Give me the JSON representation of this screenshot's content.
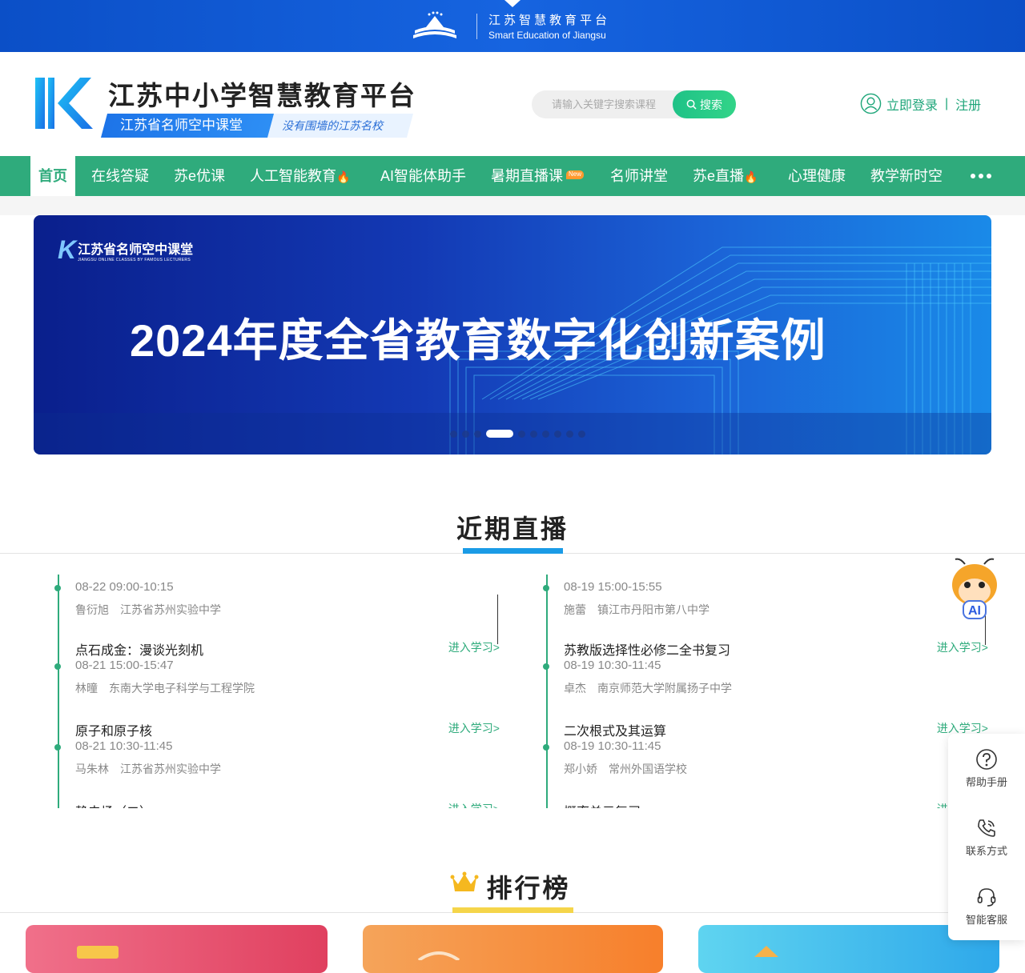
{
  "topbar": {
    "title_cn": "江苏智慧教育平台",
    "title_en": "Smart Education of Jiangsu"
  },
  "header": {
    "title": "江苏中小学智慧教育平台",
    "subtitle": "江苏省名师空中课堂",
    "slogan": "没有围墙的江苏名校",
    "search": {
      "placeholder": "请输入关键字搜索课程",
      "button": "搜索"
    },
    "login": "立即登录",
    "register": "注册"
  },
  "nav": {
    "items": [
      {
        "label": "首页",
        "active": true
      },
      {
        "label": "在线答疑"
      },
      {
        "label": "苏e优课"
      },
      {
        "label": "人工智能教育",
        "badge": "fire"
      },
      {
        "label": "AI智能体助手"
      },
      {
        "label": "暑期直播课",
        "badge": "New"
      },
      {
        "label": "名师讲堂"
      },
      {
        "label": "苏e直播",
        "badge": "fire"
      },
      {
        "label": "心理健康"
      },
      {
        "label": "教学新时空"
      }
    ],
    "more_icon": "more-dots-icon"
  },
  "banner": {
    "logo_title": "江苏省名师空中课堂",
    "logo_sub": "JIANGSU ONLINE CLASSES BY FAMOUS LECTURERS",
    "headline": "2024年度全省教育数字化创新案例",
    "active_slide": 3,
    "slide_count": 10
  },
  "live_section": {
    "title": "近期直播",
    "enter_label": "进入学习>",
    "left": [
      {
        "title": "",
        "time": "08-22 09:00-10:15",
        "teacher": "鲁衍旭",
        "school": "江苏省苏州实验中学"
      },
      {
        "title": "点石成金：漫谈光刻机",
        "time": "08-21 15:00-15:47",
        "teacher": "林曈",
        "school": "东南大学电子科学与工程学院"
      },
      {
        "title": "原子和原子核",
        "time": "08-21 10:30-11:45",
        "teacher": "马朱林",
        "school": "江苏省苏州实验中学"
      },
      {
        "title": "静电场（二）",
        "time": "",
        "teacher": "",
        "school": ""
      }
    ],
    "right": [
      {
        "title": "",
        "time": "08-19 15:00-15:55",
        "teacher": "施蕾",
        "school": "镇江市丹阳市第八中学"
      },
      {
        "title": "苏教版选择性必修二全书复习",
        "time": "08-19 10:30-11:45",
        "teacher": "卓杰",
        "school": "南京师范大学附属扬子中学"
      },
      {
        "title": "二次根式及其运算",
        "time": "08-19 10:30-11:45",
        "teacher": "郑小娇",
        "school": "常州外国语学校"
      },
      {
        "title": "概率单元复习",
        "time": "",
        "teacher": "",
        "school": ""
      }
    ]
  },
  "rank_section": {
    "title": "排行榜"
  },
  "side_tools": [
    {
      "label": "帮助手册",
      "icon": "help-icon"
    },
    {
      "label": "联系方式",
      "icon": "phone-icon"
    },
    {
      "label": "智能客服",
      "icon": "headset-icon"
    }
  ],
  "colors": {
    "primary_green": "#2fab7c",
    "top_blue": "#1664e0",
    "live_bar": "#1a9be6",
    "rank_bar": "#f5d54a"
  }
}
